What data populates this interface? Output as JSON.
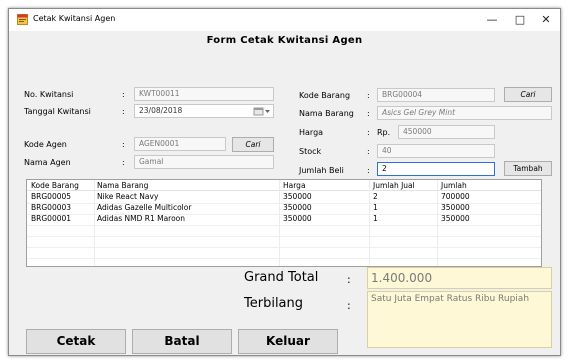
{
  "window": {
    "title": "Cetak Kwitansi Agen",
    "minimize": "—",
    "maximize": "□",
    "close": "✕"
  },
  "form_title": "Form Cetak Kwitansi Agen",
  "left": {
    "no_kwitansi_label": "No. Kwitansi",
    "no_kwitansi_value": "KWT00011",
    "tanggal_label": "Tanggal Kwitansi",
    "tanggal_value": "23/08/2018",
    "kode_agen_label": "Kode Agen",
    "kode_agen_value": "AGEN0001",
    "cari_label": "Cari",
    "nama_agen_label": "Nama Agen",
    "nama_agen_value": "Gamal"
  },
  "right": {
    "kode_barang_label": "Kode Barang",
    "kode_barang_value": "BRG00004",
    "cari_label": "Cari",
    "nama_barang_label": "Nama Barang",
    "nama_barang_value": "Asics Gel Grey Mint",
    "harga_label": "Harga",
    "harga_currency": "Rp.",
    "harga_value": "450000",
    "stock_label": "Stock",
    "stock_value": "40",
    "jumlah_beli_label": "Jumlah Beli",
    "jumlah_beli_value": "2",
    "tambah_label": "Tambah"
  },
  "colon": ":",
  "grid": {
    "columns": [
      "Kode Barang",
      "Nama Barang",
      "Harga",
      "Jumlah Jual",
      "Jumlah"
    ],
    "rows": [
      [
        "BRG00005",
        "Nike React Navy",
        "350000",
        "2",
        "700000"
      ],
      [
        "BRG00003",
        "Adidas Gazelle Multicolor",
        "350000",
        "1",
        "350000"
      ],
      [
        "BRG00001",
        "Adidas NMD R1 Maroon",
        "350000",
        "1",
        "350000"
      ]
    ]
  },
  "summary": {
    "grand_total_label": "Grand Total",
    "grand_total_value": "1.400.000",
    "terbilang_label": "Terbilang",
    "terbilang_value": "Satu Juta Empat Ratus  Ribu Rupiah"
  },
  "buttons": {
    "cetak": "Cetak",
    "batal": "Batal",
    "keluar": "Keluar"
  },
  "icons": {
    "app": "app-window-icon",
    "calendar": "calendar-icon"
  }
}
